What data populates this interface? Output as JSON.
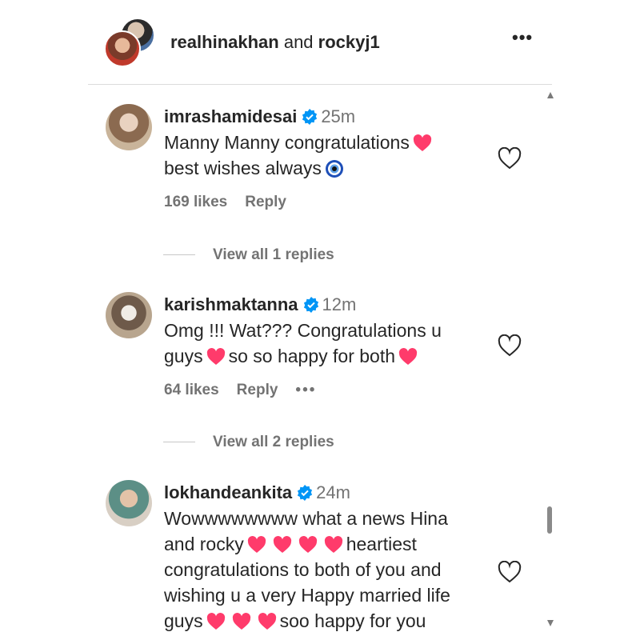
{
  "header": {
    "user1": "realhinakhan",
    "conj": " and ",
    "user2": "rockyj1",
    "more": "•••"
  },
  "comments": [
    {
      "username": "imrashamidesai",
      "time": "25m",
      "lines": [
        "Manny Manny congratulations",
        "best wishes always"
      ],
      "likes": "169 likes",
      "reply": "Reply",
      "view_replies": "View all 1 replies"
    },
    {
      "username": "karishmaktanna",
      "time": "12m",
      "lines": [
        "Omg !!! Wat??? Congratulations u",
        "guys",
        "so so happy for both"
      ],
      "likes": "64 likes",
      "reply": "Reply",
      "more": "•••",
      "view_replies": "View all 2 replies"
    },
    {
      "username": "lokhandeankita",
      "time": "24m",
      "lines": [
        "Wowwwwwwww what a news Hina",
        "and rocky",
        "heartiest",
        "congratulations to both of you and",
        "wishing u a very Happy married life",
        "guys",
        "soo happy for you"
      ]
    }
  ],
  "icons": {
    "verified": "verified-badge-icon",
    "like": "heart-outline-icon",
    "heart_emoji": "red-heart-emoji",
    "eye_emoji": "nazar-amulet-emoji"
  },
  "colors": {
    "verified": "#0095f6",
    "heart": "#ff3b6b",
    "meta": "#737373"
  }
}
